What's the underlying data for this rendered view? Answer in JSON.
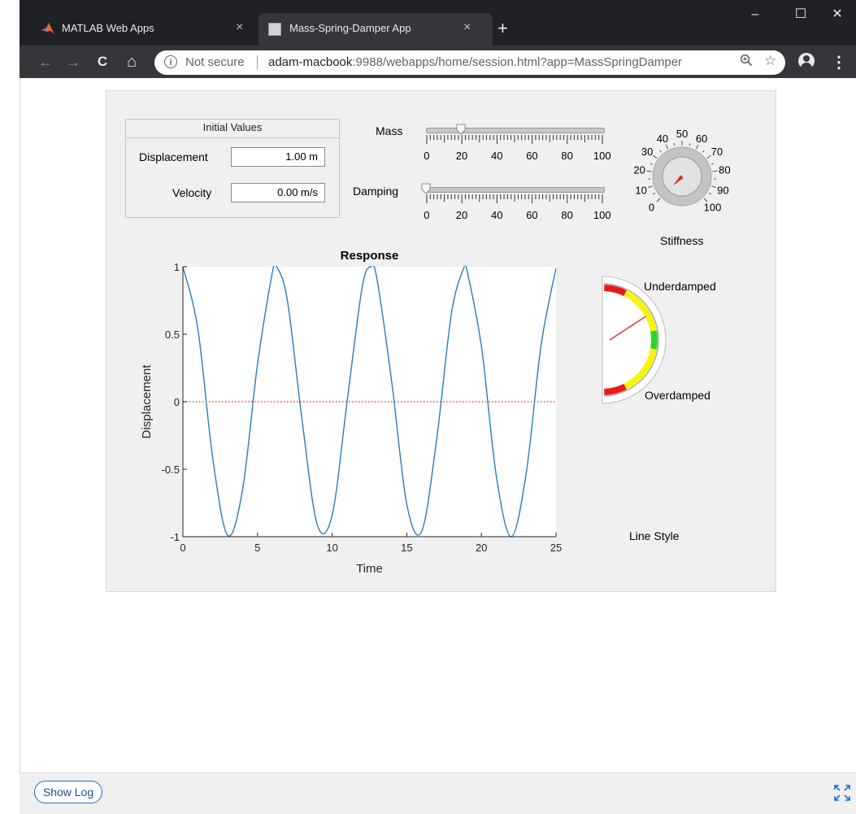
{
  "browser": {
    "tabs": [
      {
        "title": "MATLAB Web Apps",
        "active": false
      },
      {
        "title": "Mass-Spring-Damper App",
        "active": true
      }
    ],
    "new_tab": "+",
    "window_controls": {
      "minimize": "–",
      "maximize": "☐",
      "close": "✕"
    },
    "nav": {
      "back": "←",
      "forward": "→",
      "reload": "C",
      "home": "⌂"
    },
    "omnibox": {
      "info": "i",
      "security": "Not secure",
      "url_host": "adam-macbook",
      "url_path": ":9988/webapps/home/session.html?app=MassSpringDamper"
    },
    "menu": "⋮"
  },
  "app": {
    "initial_values": {
      "title": "Initial Values",
      "displacement_label": "Displacement",
      "displacement_value": "1.00 m",
      "velocity_label": "Velocity",
      "velocity_value": "0.00 m/s"
    },
    "mass_slider": {
      "label": "Mass",
      "value": 20,
      "ticks": [
        "0",
        "20",
        "40",
        "60",
        "80",
        "100"
      ]
    },
    "damping_slider": {
      "label": "Damping",
      "value": 0,
      "ticks": [
        "0",
        "20",
        "40",
        "60",
        "80",
        "100"
      ]
    },
    "stiffness_knob": {
      "label": "Stiffness",
      "value": 0,
      "ticks": [
        "0",
        "10",
        "20",
        "30",
        "40",
        "50",
        "60",
        "70",
        "80",
        "90",
        "100"
      ]
    },
    "damping_gauge": {
      "top_label": "Underdamped",
      "bottom_label": "Overdamped",
      "colors": {
        "red": "#e8191c",
        "yellow": "#f8f40c",
        "green": "#2fd32a"
      },
      "needle": "#e03b3b"
    },
    "line_style_label": "Line Style",
    "show_log": "Show Log"
  },
  "chart_data": {
    "type": "line",
    "title": "Response",
    "xlabel": "Time",
    "ylabel": "Displacement",
    "xlim": [
      0,
      25
    ],
    "ylim": [
      -1,
      1
    ],
    "xticks": [
      "0",
      "5",
      "10",
      "15",
      "20",
      "25"
    ],
    "yticks": [
      "-1",
      "-0.5",
      "0",
      "0.5",
      "1"
    ],
    "grid": false,
    "series": [
      {
        "style": "solid",
        "color": "#2b7bbf",
        "x": [
          0,
          1,
          2,
          3,
          4,
          5,
          6,
          6.28,
          7,
          8,
          9,
          10,
          11,
          12,
          12.57,
          13,
          14,
          15,
          16,
          17,
          18,
          18.85,
          19,
          20,
          21,
          22,
          23,
          24,
          25
        ],
        "y": [
          1.0,
          0.54,
          -0.42,
          -0.99,
          -0.65,
          0.28,
          0.96,
          1.0,
          0.75,
          -0.15,
          -0.91,
          -0.84,
          0.0,
          0.84,
          1.0,
          0.91,
          0.14,
          -0.76,
          -0.96,
          -0.28,
          0.66,
          1.0,
          0.99,
          0.41,
          -0.55,
          -1.0,
          -0.53,
          0.42,
          0.99
        ]
      },
      {
        "style": "dotted",
        "color": "#d9531e",
        "x": [
          0,
          25
        ],
        "y": [
          0,
          0
        ]
      }
    ]
  }
}
